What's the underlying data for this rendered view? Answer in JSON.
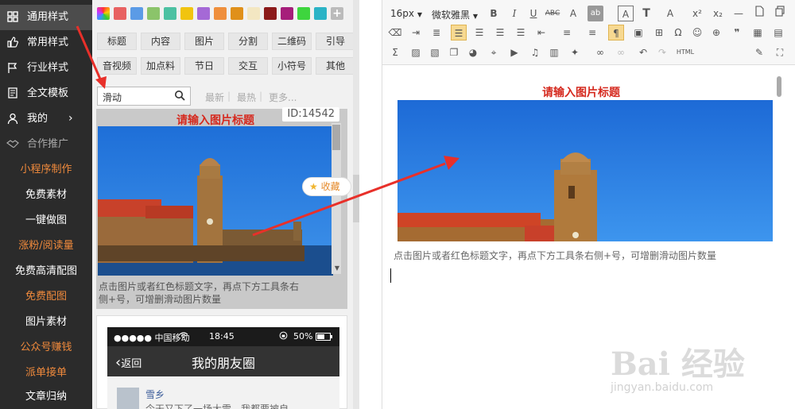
{
  "sidebar": {
    "items": [
      {
        "label": "通用样式",
        "icon": "grid-icon",
        "active": true
      },
      {
        "label": "常用样式",
        "icon": "thumbs-up-icon"
      },
      {
        "label": "行业样式",
        "icon": "flag-icon"
      },
      {
        "label": "全文模板",
        "icon": "document-icon"
      },
      {
        "label": "我的",
        "icon": "user-icon",
        "chevron": "›"
      },
      {
        "label": "合作推广",
        "icon": "handshake-icon"
      }
    ],
    "sub_items": [
      {
        "label": "小程序制作",
        "orange": true
      },
      {
        "label": "免费素材"
      },
      {
        "label": "一键做图"
      },
      {
        "label": "涨粉/阅读量",
        "orange": true
      },
      {
        "label": "免费高清配图"
      },
      {
        "label": "免费配图",
        "orange": true
      },
      {
        "label": "图片素材"
      },
      {
        "label": "公众号赚钱",
        "orange": true
      },
      {
        "label": "派单接单",
        "orange": true
      },
      {
        "label": "文章归纳"
      }
    ]
  },
  "panel": {
    "colors": [
      "#e86161",
      "#5b9be6",
      "#8bc46a",
      "#4cc1a2",
      "#f1c40f",
      "#a569d6",
      "#ef8f3c",
      "#e0901a",
      "#f3e7c2",
      "#8b1a1a",
      "#a61e7a",
      "#3ed53e",
      "#2bb3c6"
    ],
    "add_color_label": "+",
    "categories_row1": [
      "标题",
      "内容",
      "图片",
      "分割",
      "二维码",
      "引导"
    ],
    "categories_row2": [
      "音视频",
      "加点料",
      "节日",
      "交互",
      "小符号",
      "其他"
    ],
    "search": {
      "value": "滑动"
    },
    "filters": [
      "最新",
      "最热",
      "更多..."
    ],
    "card1": {
      "title": "请输入图片标题",
      "id": "ID:14542",
      "desc": "点击图片或者红色标题文字，再点下方工具条右侧+号，可增删滑动图片数量",
      "fav_label": "收藏"
    },
    "card2": {
      "carrier": "●●●●● 中国移动",
      "time": "18:45",
      "battery": "50%",
      "back_label": "返回",
      "title": "我的朋友圈",
      "friend_name": "雪乡",
      "friend_msg": "今天又下了一场大雪，我都要被自"
    }
  },
  "editor": {
    "font_size": "16px",
    "font_family": "微软雅黑",
    "html_label": "HTML",
    "doc": {
      "title": "请输入图片标题",
      "desc": "点击图片或者红色标题文字，再点下方工具条右侧+号，可增删滑动图片数量"
    }
  },
  "watermark": {
    "text": "Bai 经验",
    "url": "jingyan.baidu.com"
  },
  "colors": {
    "sidebar_bg": "#2b2b2b",
    "accent_orange": "#f08a3c",
    "title_red": "#d52a1f",
    "arrow_red": "#e8302a"
  }
}
